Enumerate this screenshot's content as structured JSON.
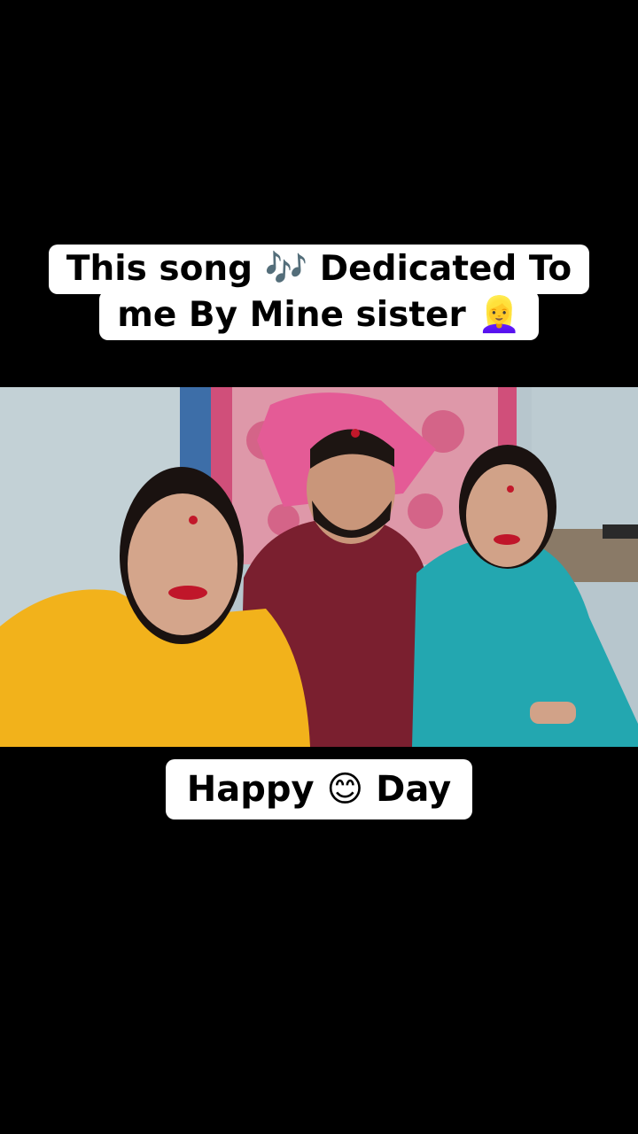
{
  "caption_top": {
    "line1": "This song 🎶 Dedicated To",
    "line2": "me By Mine sister 👱‍♀️"
  },
  "caption_bottom": "Happy 😊 Day",
  "colors": {
    "background": "#000000",
    "caption_bg": "#ffffff",
    "wall": "#b9c8cf",
    "curtain": "#d45079",
    "shirt": "#7a1f2f",
    "yellow_dupatta": "#f2b21b",
    "teal_suit": "#23a7b0"
  }
}
